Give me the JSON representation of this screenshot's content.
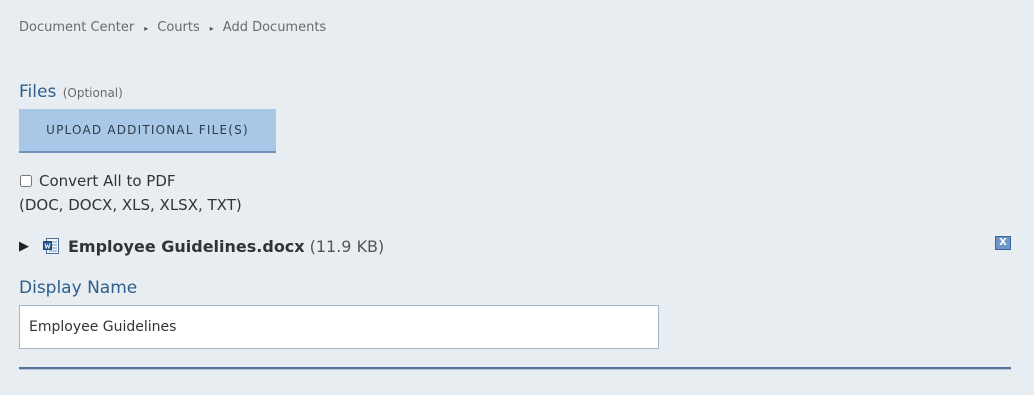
{
  "breadcrumb": {
    "items": [
      "Document Center",
      "Courts",
      "Add Documents"
    ],
    "separator": "▸"
  },
  "files": {
    "label": "Files",
    "optional": "(Optional)",
    "upload_button": "UPLOAD ADDITIONAL FILE(S)",
    "convert_label": "Convert All to PDF",
    "convert_checked": false,
    "file_types": "(DOC, DOCX, XLS, XLSX, TXT)"
  },
  "file_item": {
    "expand_icon": "▶",
    "name": "Employee Guidelines.docx",
    "size": "(11.9 KB)",
    "remove_label": "X"
  },
  "display_name": {
    "label": "Display Name",
    "value": "Employee Guidelines"
  },
  "colors": {
    "background": "#e8edf2",
    "accent_text": "#2d5e8a",
    "button_bg": "#a9c7e6",
    "remove_bg": "#6f95c6"
  }
}
